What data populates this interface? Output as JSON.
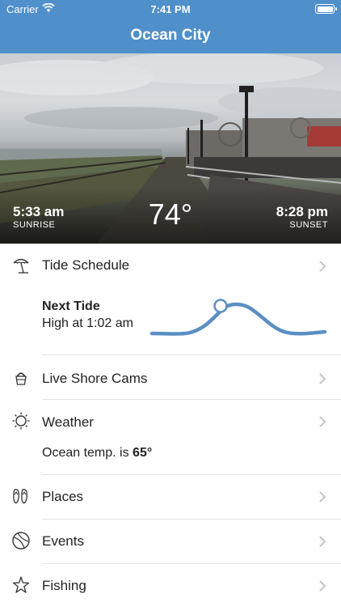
{
  "status_bar": {
    "carrier": "Carrier",
    "time": "7:41 PM",
    "battery_level": 1.0
  },
  "navbar": {
    "title": "Ocean City"
  },
  "hero": {
    "sunrise_time": "5:33 am",
    "sunrise_label": "SUNRISE",
    "temperature": "74°",
    "sunset_time": "8:28 pm",
    "sunset_label": "SUNSET"
  },
  "tide": {
    "label": "Tide Schedule",
    "icon": "beach-umbrella-icon",
    "next_title": "Next Tide",
    "next_detail": "High at 1:02 am"
  },
  "cams": {
    "label": "Live Shore Cams",
    "icon": "sand-bucket-icon"
  },
  "weather": {
    "label": "Weather",
    "icon": "sun-icon",
    "ocean_temp_prefix": "Ocean temp. is ",
    "ocean_temp_value": "65°"
  },
  "places": {
    "label": "Places",
    "icon": "flip-flops-icon"
  },
  "events": {
    "label": "Events",
    "icon": "beach-ball-icon"
  },
  "fishing": {
    "label": "Fishing",
    "icon": "starfish-icon"
  },
  "colors": {
    "accent": "#4f8fca",
    "tide_line": "#5b8fc4",
    "chevron": "#c4c4c9",
    "divider": "#e3e3e6"
  }
}
